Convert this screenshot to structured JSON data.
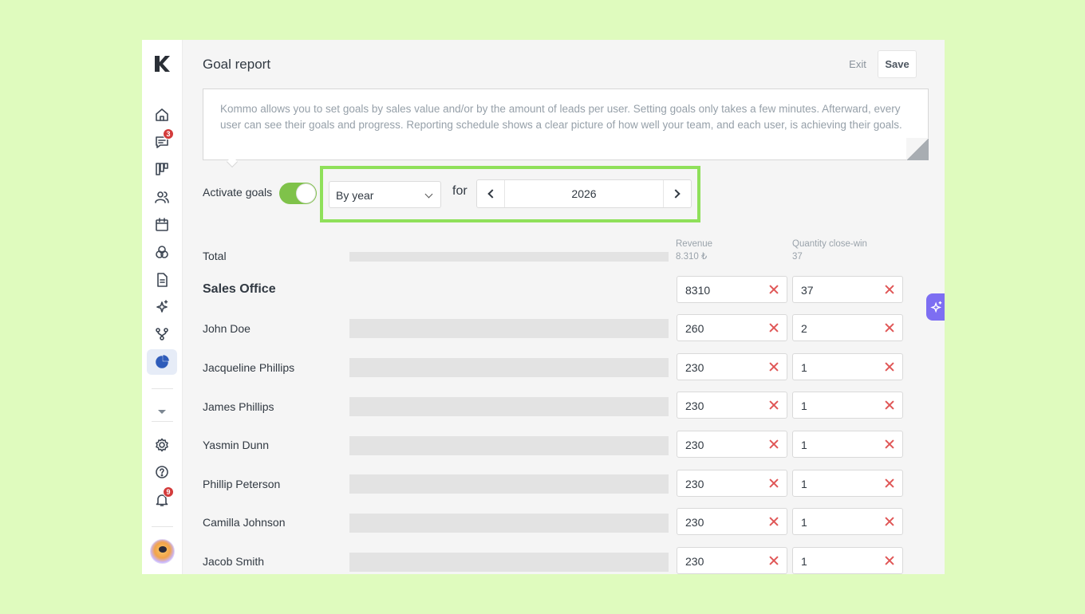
{
  "header": {
    "title": "Goal report",
    "exit_label": "Exit",
    "save_label": "Save"
  },
  "sidebar": {
    "items": [
      {
        "name": "home",
        "icon": "home-icon"
      },
      {
        "name": "chats",
        "icon": "chat-icon",
        "badge": "3"
      },
      {
        "name": "leads",
        "icon": "pipeline-icon"
      },
      {
        "name": "contacts",
        "icon": "contacts-icon"
      },
      {
        "name": "calendar",
        "icon": "calendar-icon"
      },
      {
        "name": "catalogs",
        "icon": "circles-icon"
      },
      {
        "name": "documents",
        "icon": "document-icon"
      },
      {
        "name": "ai",
        "icon": "sparkles-icon"
      },
      {
        "name": "automation",
        "icon": "flow-icon"
      },
      {
        "name": "stats",
        "icon": "pie-chart-icon",
        "active": true
      }
    ],
    "bottom": [
      {
        "name": "settings",
        "icon": "gear-icon"
      },
      {
        "name": "help",
        "icon": "help-icon"
      },
      {
        "name": "notifications",
        "icon": "bell-icon",
        "badge": "9"
      }
    ]
  },
  "info": {
    "text": "Kommo allows you to set goals by sales value and/or by the amount of leads per user. Setting goals only takes a few minutes. Afterward, every user can see their goals and progress. Reporting schedule shows a clear picture of how well your team, and each user, is achieving their goals."
  },
  "controls": {
    "activate_label": "Activate goals",
    "activate_on": true,
    "period_value": "By year",
    "for_label": "for",
    "year": "2026"
  },
  "table": {
    "revenue_header": "Revenue",
    "quantity_header": "Quantity close-win",
    "total_label": "Total",
    "total_revenue": "8.310 ₺",
    "total_quantity": "37",
    "group": {
      "name": "Sales Office",
      "revenue": "8310",
      "quantity": "37"
    },
    "rows": [
      {
        "name": "John Doe",
        "revenue": "260",
        "quantity": "2"
      },
      {
        "name": "Jacqueline Phillips",
        "revenue": "230",
        "quantity": "1"
      },
      {
        "name": "James Phillips",
        "revenue": "230",
        "quantity": "1"
      },
      {
        "name": "Yasmin Dunn",
        "revenue": "230",
        "quantity": "1"
      },
      {
        "name": "Phillip Peterson",
        "revenue": "230",
        "quantity": "1"
      },
      {
        "name": "Camilla Johnson",
        "revenue": "230",
        "quantity": "1"
      },
      {
        "name": "Jacob Smith",
        "revenue": "230",
        "quantity": "1"
      }
    ]
  },
  "colors": {
    "accent_green": "#7fc24a",
    "highlight": "#8fe05a",
    "clear_red": "#e05656",
    "active_nav": "#2f5cba"
  }
}
